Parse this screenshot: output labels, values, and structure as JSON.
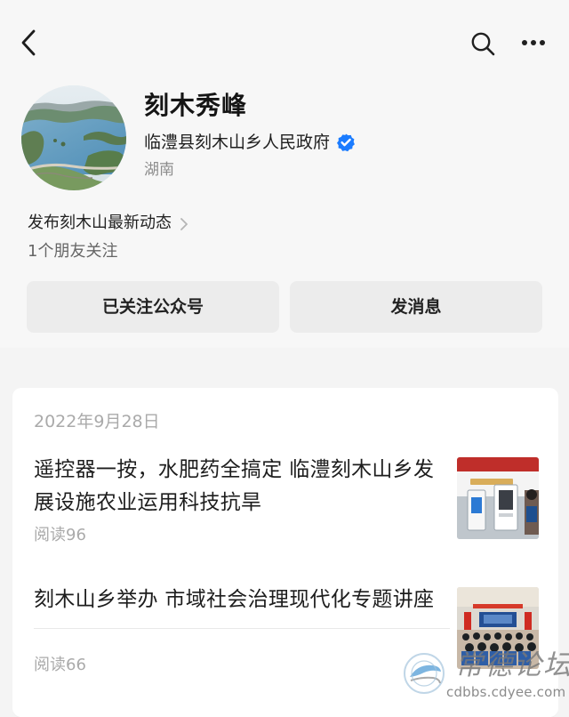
{
  "header": {
    "back_icon": "chevron-left-icon",
    "search_icon": "search-icon",
    "more_icon": "more-horizontal-icon"
  },
  "profile": {
    "name": "刻木秀峰",
    "organization": "临澧县刻木山乡人民政府",
    "verified_icon": "verified-badge-icon",
    "location": "湖南",
    "intro": "发布刻木山最新动态",
    "friends_follow": "1个朋友关注",
    "follow_button": "已关注公众号",
    "message_button": "发消息"
  },
  "feed": {
    "date": "2022年9月28日",
    "articles": [
      {
        "title": "遥控器一按，水肥药全搞定 临澧刻木山乡发展设施农业运用科技抗旱",
        "reads": "阅读96",
        "thumbnail": "article-thumbnail"
      },
      {
        "title": "刻木山乡举办 市域社会治理现代化专题讲座",
        "reads": "阅读66",
        "thumbnail": "article-thumbnail"
      }
    ]
  },
  "watermark": {
    "title": "常德论坛",
    "url": "cdbbs.cdyee.com"
  },
  "colors": {
    "background": "#f4f4f4",
    "card": "#ffffff",
    "button": "#ececec",
    "verified_blue": "#1b7cff",
    "muted_text": "#aaaaaa"
  }
}
